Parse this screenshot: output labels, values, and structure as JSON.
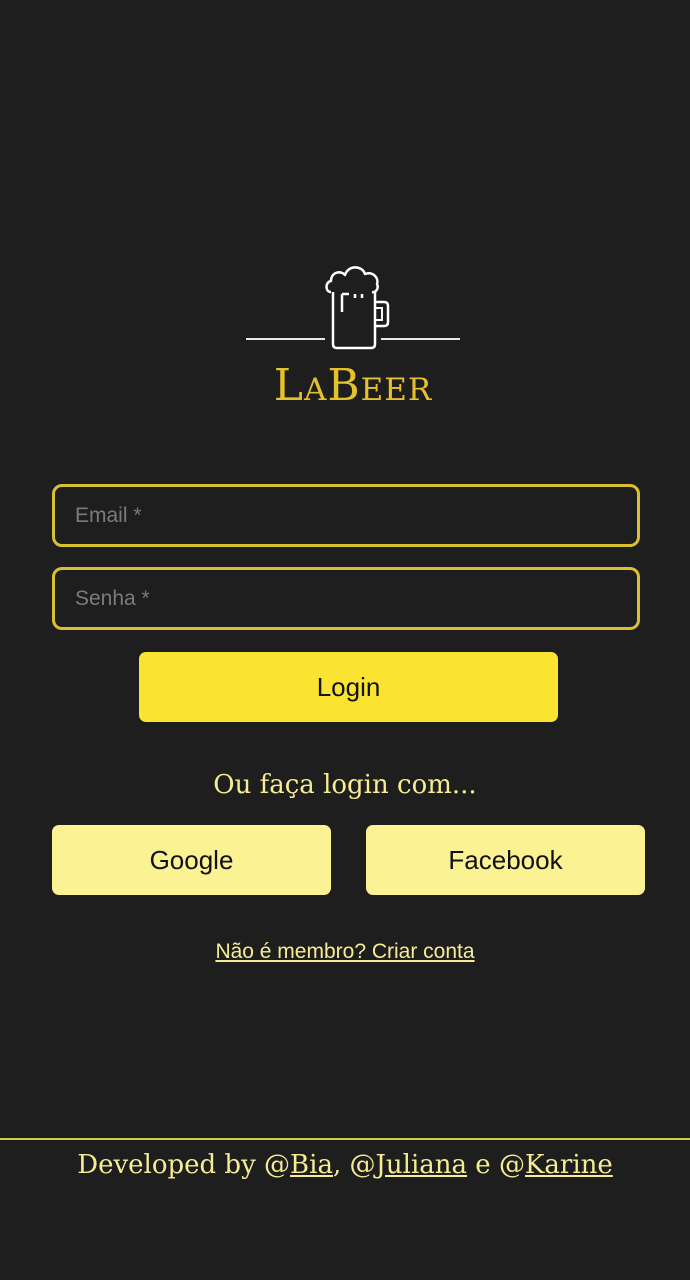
{
  "app": {
    "brand": "LaBeer",
    "logo_icon": "beer-mug-icon"
  },
  "login_form": {
    "email_placeholder": "Email *",
    "email_value": "",
    "password_placeholder": "Senha *",
    "password_value": "",
    "login_label": "Login"
  },
  "social": {
    "prompt": "Ou faça login com...",
    "google_label": "Google",
    "facebook_label": "Facebook"
  },
  "signup": {
    "link_label": "Não é membro? Criar conta"
  },
  "footer": {
    "prefix": "Developed by @",
    "author1": "Bia",
    "sep1": ", @",
    "author2": "Juliana",
    "sep2": " e @",
    "author3": "Karine"
  },
  "colors": {
    "background": "#1e1e1e",
    "accent": "#fbe431",
    "accent_light": "#fbf294",
    "brand_gold": "#e6c12e"
  }
}
